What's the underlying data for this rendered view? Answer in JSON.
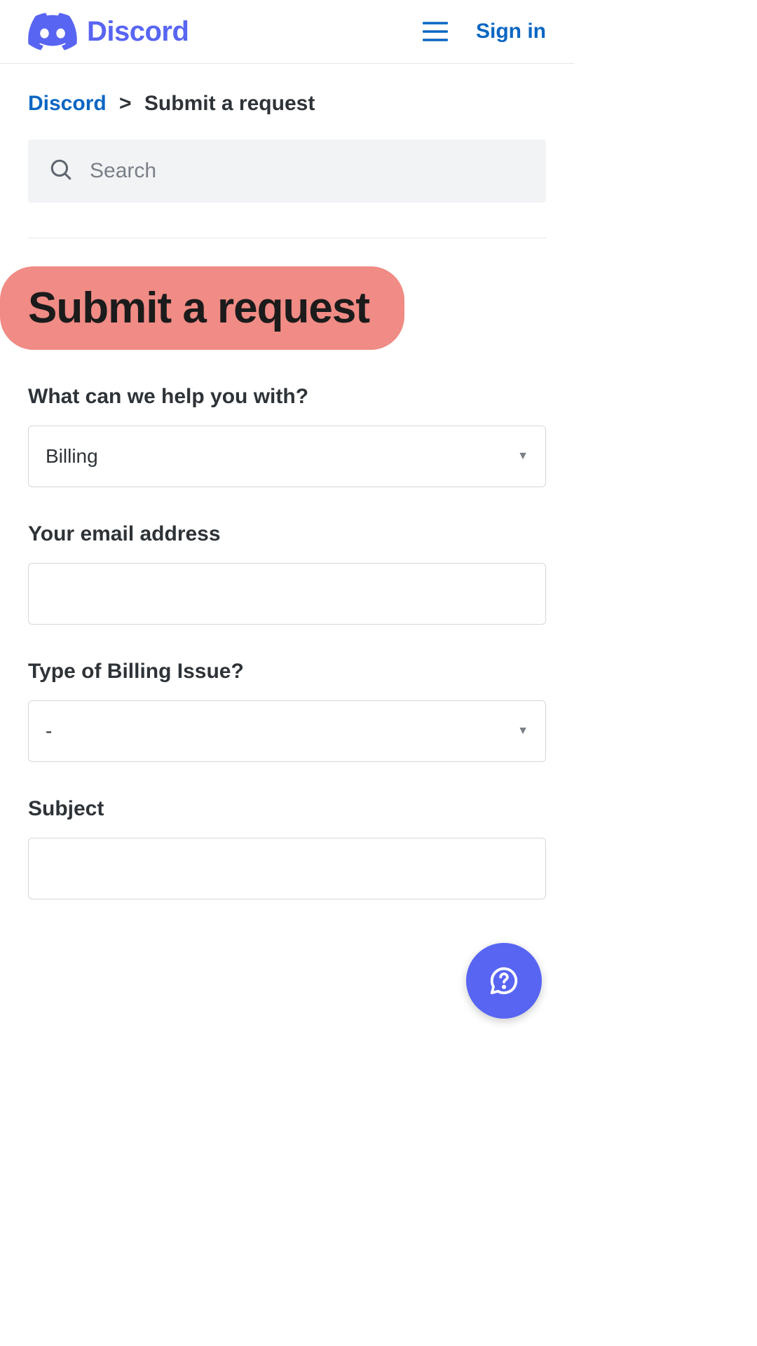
{
  "header": {
    "brand": "Discord",
    "signin": "Sign in"
  },
  "breadcrumb": {
    "root": "Discord",
    "sep": ">",
    "current": "Submit a request"
  },
  "search": {
    "placeholder": "Search"
  },
  "title": "Submit a request",
  "form": {
    "help_label": "What can we help you with?",
    "help_value": "Billing",
    "email_label": "Your email address",
    "email_value": "",
    "billing_type_label": "Type of Billing Issue?",
    "billing_type_value": "-",
    "subject_label": "Subject",
    "subject_value": ""
  },
  "icons": {
    "hamburger": "menu-icon",
    "search": "search-icon",
    "help_fab": "question-icon"
  }
}
